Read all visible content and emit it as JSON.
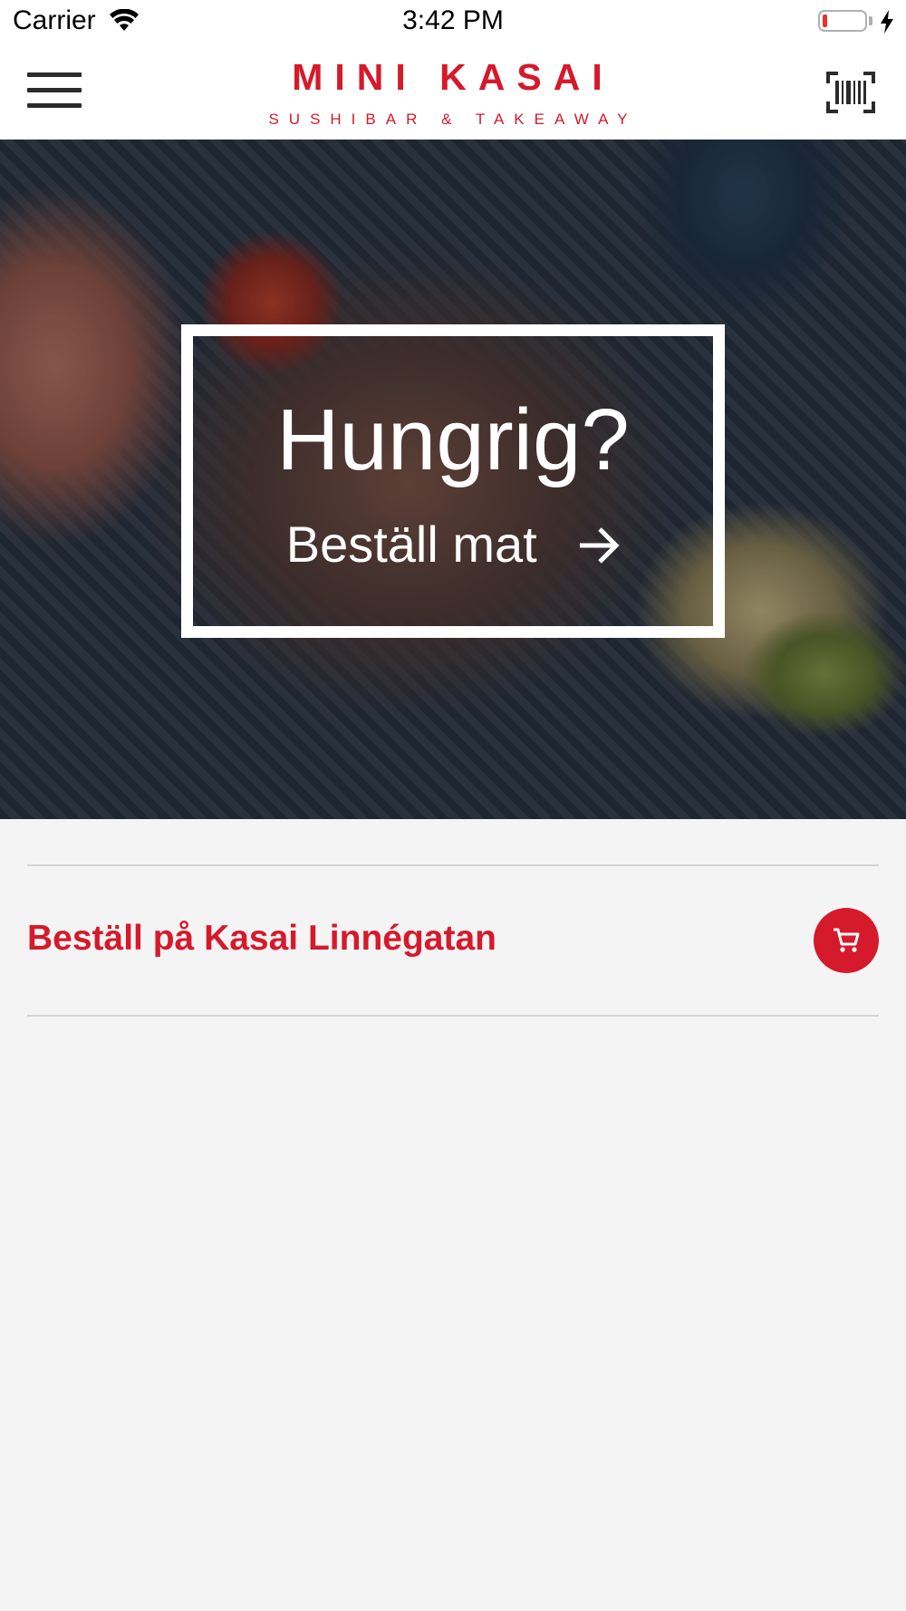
{
  "status_bar": {
    "carrier": "Carrier",
    "time": "3:42 PM",
    "icons": [
      "wifi-icon",
      "battery-icon",
      "charging-bolt-icon"
    ]
  },
  "header": {
    "logo_main": "MINI KASAI",
    "logo_sub": "SUSHIBAR & TAKEAWAY",
    "menu_icon": "hamburger-menu-icon",
    "scan_icon": "barcode-scanner-icon"
  },
  "hero": {
    "title": "Hungrig?",
    "cta": "Beställ mat",
    "cta_icon": "arrow-right-icon"
  },
  "locations": [
    {
      "label": "Beställ på Kasai Linnégatan",
      "icon": "cart-icon"
    }
  ],
  "colors": {
    "brand_red": "#d51a2b",
    "background": "#f4f4f4",
    "divider": "#d4d4d4"
  }
}
